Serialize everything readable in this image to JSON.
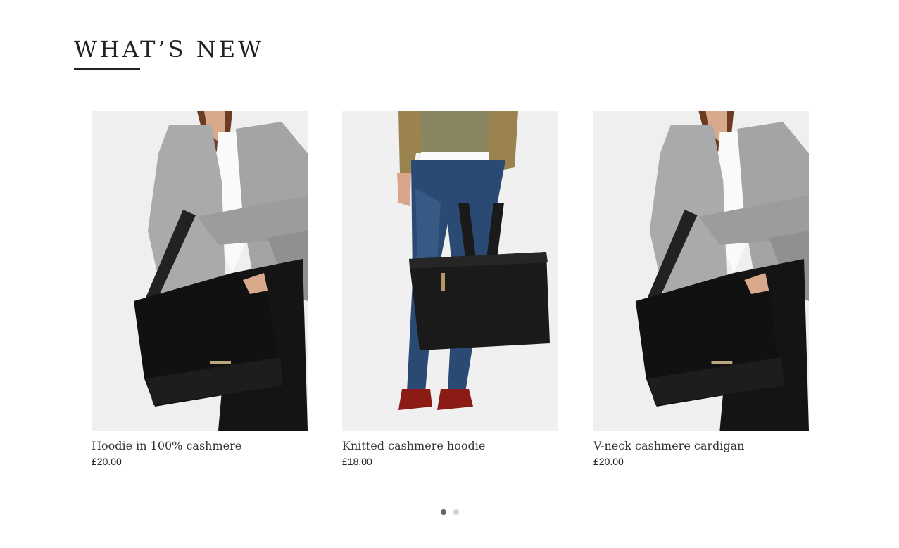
{
  "section": {
    "title": "WHAT’S NEW"
  },
  "products": [
    {
      "name": "Hoodie in 100% cashmere",
      "price": "£20.00",
      "image": "woman-grey-jacket-black-shoulder-bag"
    },
    {
      "name": "Knitted cashmere hoodie",
      "price": "£18.00",
      "image": "woman-jeans-black-tote-bag"
    },
    {
      "name": "V-neck cashmere cardigan",
      "price": "£20.00",
      "image": "woman-grey-jacket-black-shoulder-bag"
    }
  ],
  "pagination": {
    "pages": 2,
    "active_index": 0
  },
  "colors": {
    "image_bg": "#f1f1f1",
    "dot_active": "#666666",
    "dot_inactive": "#d4d4d4"
  }
}
